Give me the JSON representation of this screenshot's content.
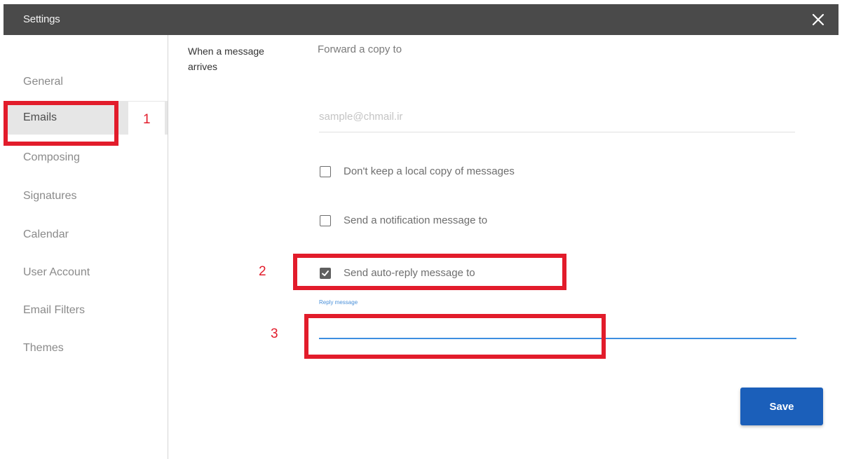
{
  "window": {
    "title": "Settings"
  },
  "sidebar": {
    "items": [
      {
        "label": "General"
      },
      {
        "label": "Emails",
        "active": true
      },
      {
        "label": "Composing"
      },
      {
        "label": "Signatures"
      },
      {
        "label": "Calendar"
      },
      {
        "label": "User Account"
      },
      {
        "label": "Email Filters"
      },
      {
        "label": "Themes"
      }
    ]
  },
  "main": {
    "section_label": "When a message arrives",
    "forward_label": "Forward a copy to",
    "forward_input": {
      "placeholder": "sample@chmail.ir",
      "value": ""
    },
    "options": [
      {
        "label": "Don't keep a local copy of messages",
        "checked": false
      },
      {
        "label": "Send a notification message to",
        "checked": false
      },
      {
        "label": "Send auto-reply message to",
        "checked": true
      }
    ],
    "reply_caption": "Reply message",
    "reply_input": {
      "value": ""
    },
    "save_label": "Save"
  },
  "annotations": {
    "markers": [
      "1",
      "2",
      "3"
    ]
  },
  "colors": {
    "titlebar": "#4a4a4a",
    "annotation": "#e21c2b",
    "accent_blue": "#3c8ee0",
    "save_button": "#1b5fba"
  },
  "icons": {
    "close": "close-icon",
    "checkmark": "checkmark-icon"
  }
}
